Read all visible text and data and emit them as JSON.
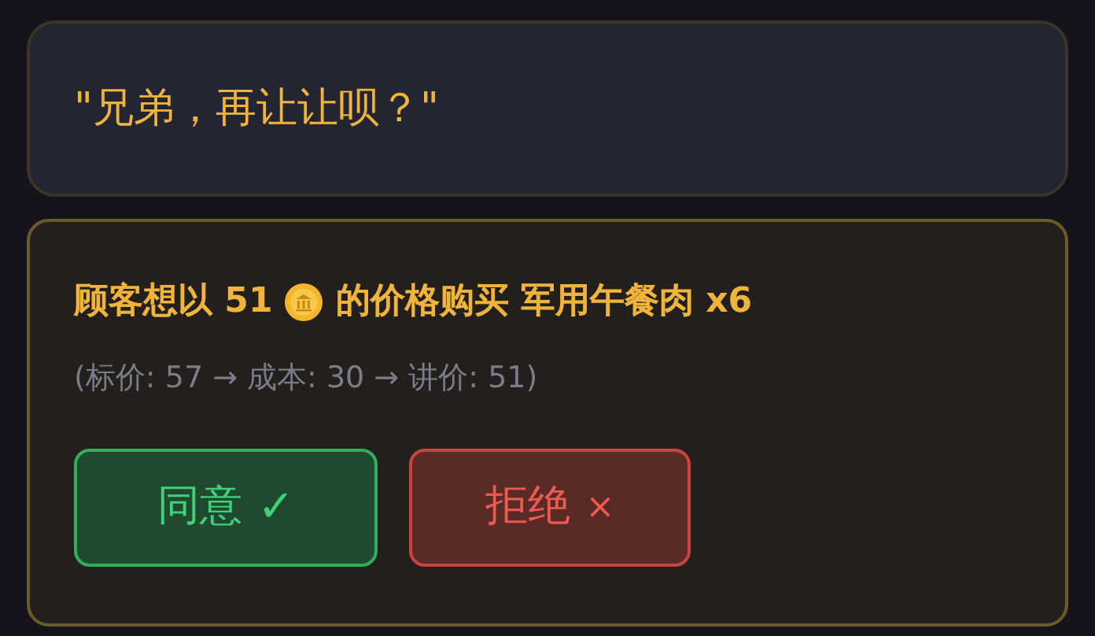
{
  "speech": {
    "text": "\"兄弟，再让让呗？\""
  },
  "offer": {
    "before_coin": "顾客想以 51",
    "after_coin": "的价格购买 军用午餐肉 x6",
    "detail": "(标价: 57 → 成本: 30 → 讲价: 51)"
  },
  "buttons": [
    {
      "kind": "accept",
      "label": "同意",
      "icon": "✓"
    },
    {
      "kind": "reject",
      "label": "拒绝",
      "icon": "×"
    }
  ]
}
